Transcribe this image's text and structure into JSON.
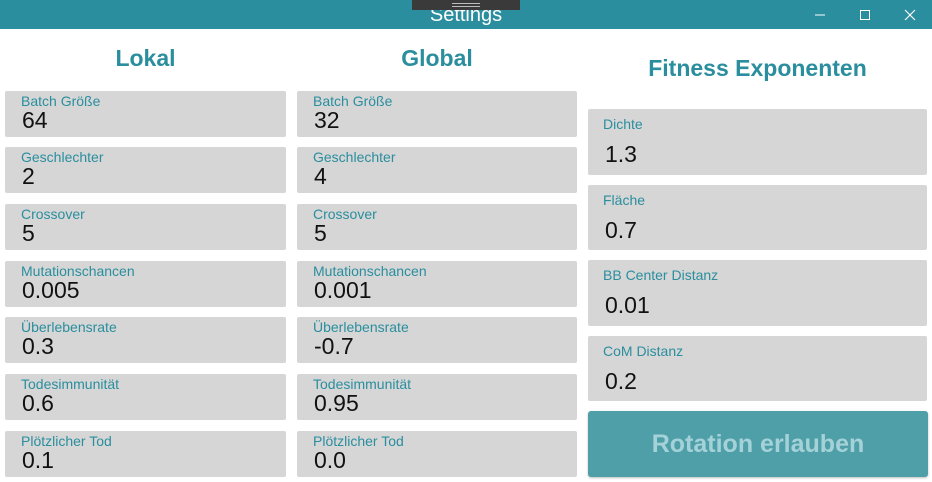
{
  "window": {
    "title": "Settings"
  },
  "columns": {
    "lokal": {
      "heading": "Lokal",
      "fields": [
        {
          "label": "Batch Größe",
          "value": "64"
        },
        {
          "label": "Geschlechter",
          "value": "2"
        },
        {
          "label": "Crossover",
          "value": "5"
        },
        {
          "label": "Mutationschancen",
          "value": "0.005"
        },
        {
          "label": "Überlebensrate",
          "value": "0.3"
        },
        {
          "label": "Todesimmunität",
          "value": "0.6"
        },
        {
          "label": "Plötzlicher Tod",
          "value": "0.1"
        }
      ]
    },
    "global": {
      "heading": "Global",
      "fields": [
        {
          "label": "Batch Größe",
          "value": "32"
        },
        {
          "label": "Geschlechter",
          "value": "4"
        },
        {
          "label": "Crossover",
          "value": "5"
        },
        {
          "label": "Mutationschancen",
          "value": "0.001"
        },
        {
          "label": "Überlebensrate",
          "value": "-0.7"
        },
        {
          "label": "Todesimmunität",
          "value": "0.95"
        },
        {
          "label": "Plötzlicher Tod",
          "value": "0.0"
        }
      ]
    },
    "fitness": {
      "heading": "Fitness Exponenten",
      "fields": [
        {
          "label": "Dichte",
          "value": "1.3"
        },
        {
          "label": "Fläche",
          "value": "0.7"
        },
        {
          "label": "BB Center Distanz",
          "value": "0.01"
        },
        {
          "label": "CoM Distanz",
          "value": "0.2"
        }
      ],
      "button_label": "Rotation erlauben"
    }
  },
  "colors": {
    "accent": "#2a8e9e",
    "field_background": "#d6d6d6",
    "button_background": "#4f9fa8",
    "button_text": "#a4d2d8"
  },
  "icons": {
    "minimize": "minimize-icon",
    "maximize": "maximize-icon",
    "close": "close-icon"
  }
}
